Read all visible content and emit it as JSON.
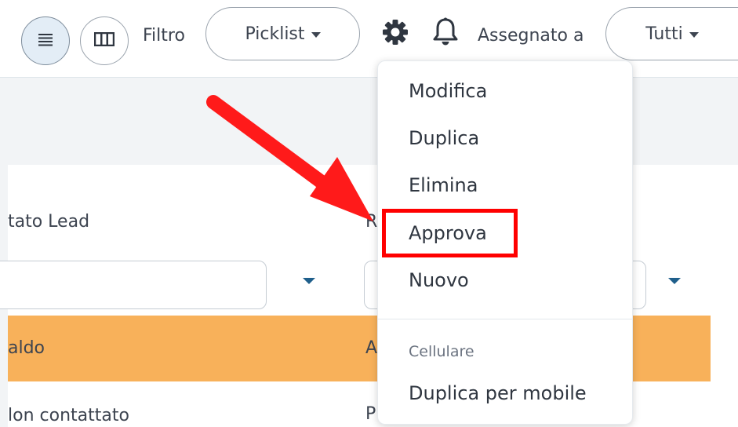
{
  "toolbar": {
    "filter_label": "Filtro",
    "picklist_label": "Picklist",
    "assigned_label": "Assegnato a",
    "assigned_value": "Tutti"
  },
  "table": {
    "column_1": "tato Lead",
    "column_2": "R",
    "rows": [
      {
        "col1": "aldo",
        "col2": "A"
      },
      {
        "col1": "lon contattato",
        "col2": "P"
      }
    ]
  },
  "menu": {
    "items": [
      {
        "label": "Modifica"
      },
      {
        "label": "Duplica"
      },
      {
        "label": "Elimina"
      },
      {
        "label": "Approva"
      },
      {
        "label": "Nuovo"
      }
    ],
    "section_label": "Cellulare",
    "section_items": [
      {
        "label": "Duplica per mobile"
      }
    ]
  },
  "colors": {
    "accent": "#1f5f8b",
    "highlight_row": "#f8b15a",
    "annotation": "#ff0000"
  }
}
